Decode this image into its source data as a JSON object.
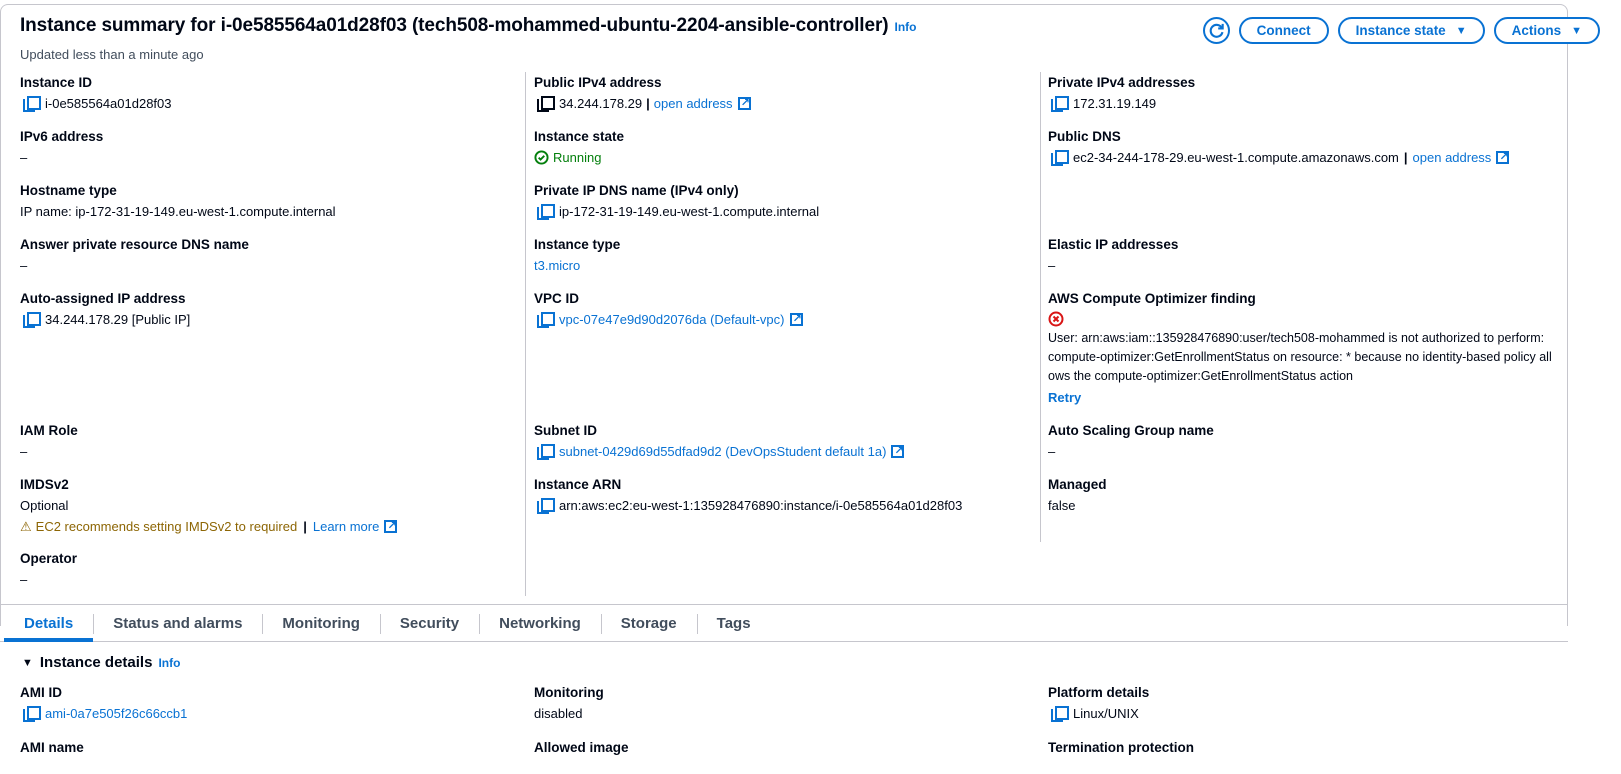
{
  "header": {
    "title": "Instance summary for i-0e585564a01d28f03 (tech508-mohammed-ubuntu-2204-ansible-controller)",
    "info": "Info",
    "updated": "Updated less than a minute ago",
    "connect_label": "Connect",
    "instance_state_label": "Instance state",
    "actions_label": "Actions"
  },
  "summary": {
    "instance_id": {
      "label": "Instance ID",
      "value": "i-0e585564a01d28f03"
    },
    "ipv6": {
      "label": "IPv6 address",
      "value": "–"
    },
    "hostname_type": {
      "label": "Hostname type",
      "value": "IP name: ip-172-31-19-149.eu-west-1.compute.internal"
    },
    "answer_dns": {
      "label": "Answer private resource DNS name",
      "value": "–"
    },
    "auto_ip": {
      "label": "Auto-assigned IP address",
      "value": "34.244.178.29 [Public IP]"
    },
    "iam_role": {
      "label": "IAM Role",
      "value": "–"
    },
    "imdsv2": {
      "label": "IMDSv2",
      "value": "Optional",
      "warning": "EC2 recommends setting IMDSv2 to required",
      "learn_more": "Learn more"
    },
    "operator": {
      "label": "Operator",
      "value": "–"
    },
    "public_ipv4": {
      "label": "Public IPv4 address",
      "value": "34.244.178.29",
      "open": "open address"
    },
    "instance_state": {
      "label": "Instance state",
      "value": "Running"
    },
    "private_dns": {
      "label": "Private IP DNS name (IPv4 only)",
      "value": "ip-172-31-19-149.eu-west-1.compute.internal"
    },
    "instance_type": {
      "label": "Instance type",
      "value": "t3.micro"
    },
    "vpc_id": {
      "label": "VPC ID",
      "value": "vpc-07e47e9d90d2076da (Default-vpc)"
    },
    "subnet_id": {
      "label": "Subnet ID",
      "value": "subnet-0429d69d55dfad9d2 (DevOpsStudent default 1a)"
    },
    "instance_arn": {
      "label": "Instance ARN",
      "value": "arn:aws:ec2:eu-west-1:135928476890:instance/i-0e585564a01d28f03"
    },
    "private_ipv4": {
      "label": "Private IPv4 addresses",
      "value": "172.31.19.149"
    },
    "public_dns": {
      "label": "Public DNS",
      "value": "ec2-34-244-178-29.eu-west-1.compute.amazonaws.com",
      "open": "open address"
    },
    "elastic_ip": {
      "label": "Elastic IP addresses",
      "value": "–"
    },
    "optimizer": {
      "label": "AWS Compute Optimizer finding",
      "message": "User: arn:aws:iam::135928476890:user/tech508-mohammed is not authorized to perform: compute-optimizer:GetEnrollmentStatus on resource: * because no identity-based policy allows the compute-optimizer:GetEnrollmentStatus action",
      "retry": "Retry"
    },
    "asg_name": {
      "label": "Auto Scaling Group name",
      "value": "–"
    },
    "managed": {
      "label": "Managed",
      "value": "false"
    }
  },
  "tabs": [
    "Details",
    "Status and alarms",
    "Monitoring",
    "Security",
    "Networking",
    "Storage",
    "Tags"
  ],
  "details": {
    "section_title": "Instance details",
    "info": "Info",
    "ami_id": {
      "label": "AMI ID",
      "value": "ami-0a7e505f26c66ccb1"
    },
    "ami_name": {
      "label": "AMI name"
    },
    "monitoring": {
      "label": "Monitoring",
      "value": "disabled"
    },
    "allowed_image": {
      "label": "Allowed image"
    },
    "platform": {
      "label": "Platform details",
      "value": "Linux/UNIX"
    },
    "termination": {
      "label": "Termination protection"
    }
  },
  "colors": {
    "link": "#0972d3",
    "running": "#037f0c",
    "warning": "#8d6605",
    "error": "#d91515"
  }
}
